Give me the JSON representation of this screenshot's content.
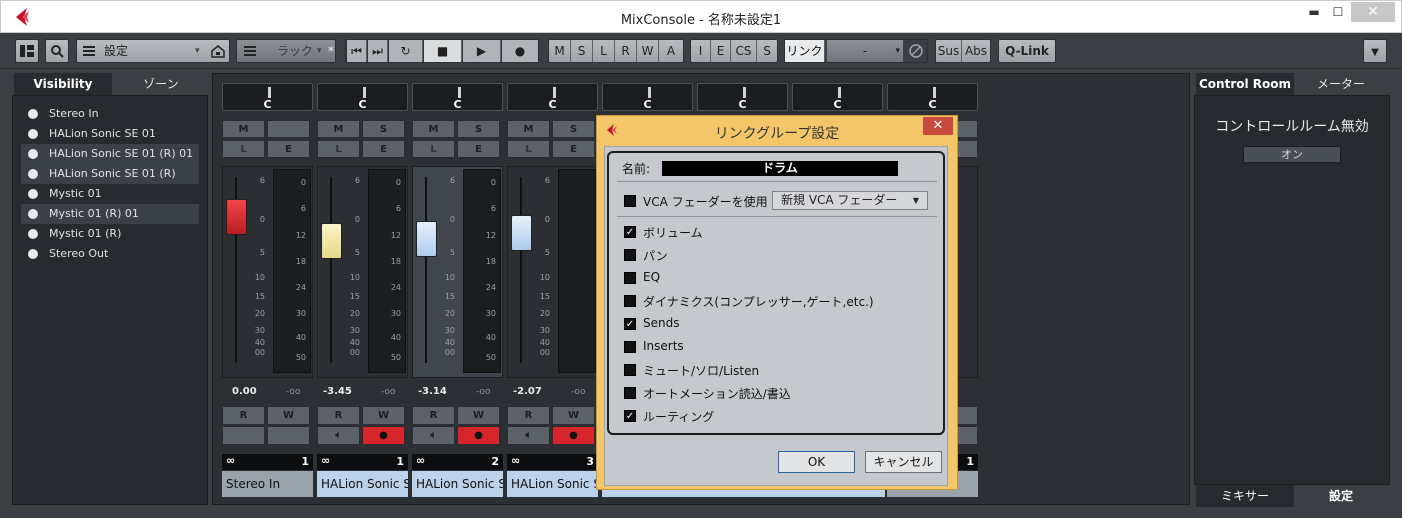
{
  "window": {
    "title": "MixConsole - 名称未設定1",
    "minimize": "▬",
    "maximize": "☐",
    "close": "✕"
  },
  "toolbar": {
    "preset_label": "設定",
    "rack_label": "ラック",
    "star": "*",
    "solo_group": [
      "M",
      "S",
      "L",
      "R",
      "W",
      "A"
    ],
    "insert_group": [
      "I",
      "E",
      "CS",
      "S"
    ],
    "link_label": "リンク",
    "link_select": "-",
    "sus": "Sus",
    "abs": "Abs",
    "qlink": "Q-Link"
  },
  "left_panel": {
    "tab_visibility": "Visibility",
    "tab_zone": "ゾーン",
    "items": [
      {
        "label": "Stereo In"
      },
      {
        "label": "HALion Sonic SE 01"
      },
      {
        "label": "HALion Sonic SE 01 (R) 01"
      },
      {
        "label": "HALion Sonic SE 01 (R)"
      },
      {
        "label": "Mystic 01"
      },
      {
        "label": "Mystic 01 (R) 01"
      },
      {
        "label": "Mystic 01 (R)"
      },
      {
        "label": "Stereo Out"
      }
    ]
  },
  "channels": [
    {
      "pan": "C",
      "volume": "0.00",
      "peak": "-oo",
      "number": "1",
      "name": "Stereo In",
      "has_s": false
    },
    {
      "pan": "C",
      "volume": "-3.45",
      "peak": "-oo",
      "number": "1",
      "name": "HALion Sonic S",
      "has_s": true
    },
    {
      "pan": "C",
      "volume": "-3.14",
      "peak": "-oo",
      "number": "2",
      "name": "HALion Sonic S",
      "has_s": true
    },
    {
      "pan": "C",
      "volume": "-2.07",
      "peak": "-oo",
      "number": "3",
      "name": "HALion Sonic S",
      "has_s": true
    },
    {
      "pan": "C"
    },
    {
      "pan": "C"
    },
    {
      "pan": "C"
    },
    {
      "pan": "C",
      "number": "1"
    }
  ],
  "strip_buttons": {
    "m": "M",
    "s": "S",
    "l": "L",
    "e": "E",
    "r": "R",
    "w": "W"
  },
  "fader_scale": [
    "6",
    "0",
    "5",
    "10",
    "15",
    "20",
    "30",
    "40",
    "00"
  ],
  "meter_scale": [
    "0",
    "6",
    "12",
    "18",
    "24",
    "30",
    "40",
    "50"
  ],
  "right_panel": {
    "tab_control_room": "Control Room",
    "tab_meter": "メーター",
    "status": "コントロールルーム無効",
    "on_button": "オン",
    "bottom_tab_mixer": "ミキサー",
    "bottom_tab_settings": "設定"
  },
  "dialog": {
    "title": "リンクグループ設定",
    "name_label": "名前:",
    "name_value": "ドラム",
    "vca_label": "VCA フェーダーを使用",
    "vca_select": "新規 VCA フェーダー",
    "options": [
      {
        "label": "ボリューム",
        "checked": true
      },
      {
        "label": "パン",
        "checked": false
      },
      {
        "label": "EQ",
        "checked": false
      },
      {
        "label": "ダイナミクス(コンプレッサー,ゲート,etc.)",
        "checked": false
      },
      {
        "label": "Sends",
        "checked": true
      },
      {
        "label": "Inserts",
        "checked": false
      },
      {
        "label": "ミュート/ソロ/Listen",
        "checked": false
      },
      {
        "label": "オートメーション読込/書込",
        "checked": false
      },
      {
        "label": "ルーティング",
        "checked": true
      }
    ],
    "ok": "OK",
    "cancel": "キャンセル"
  },
  "colors": {
    "accent_red": "#d7262b",
    "brand_red": "#c8102e",
    "dialog_frame": "#f2c76b",
    "fader_yellow": "#f4eab0",
    "fader_blue": "#c9dff5"
  }
}
